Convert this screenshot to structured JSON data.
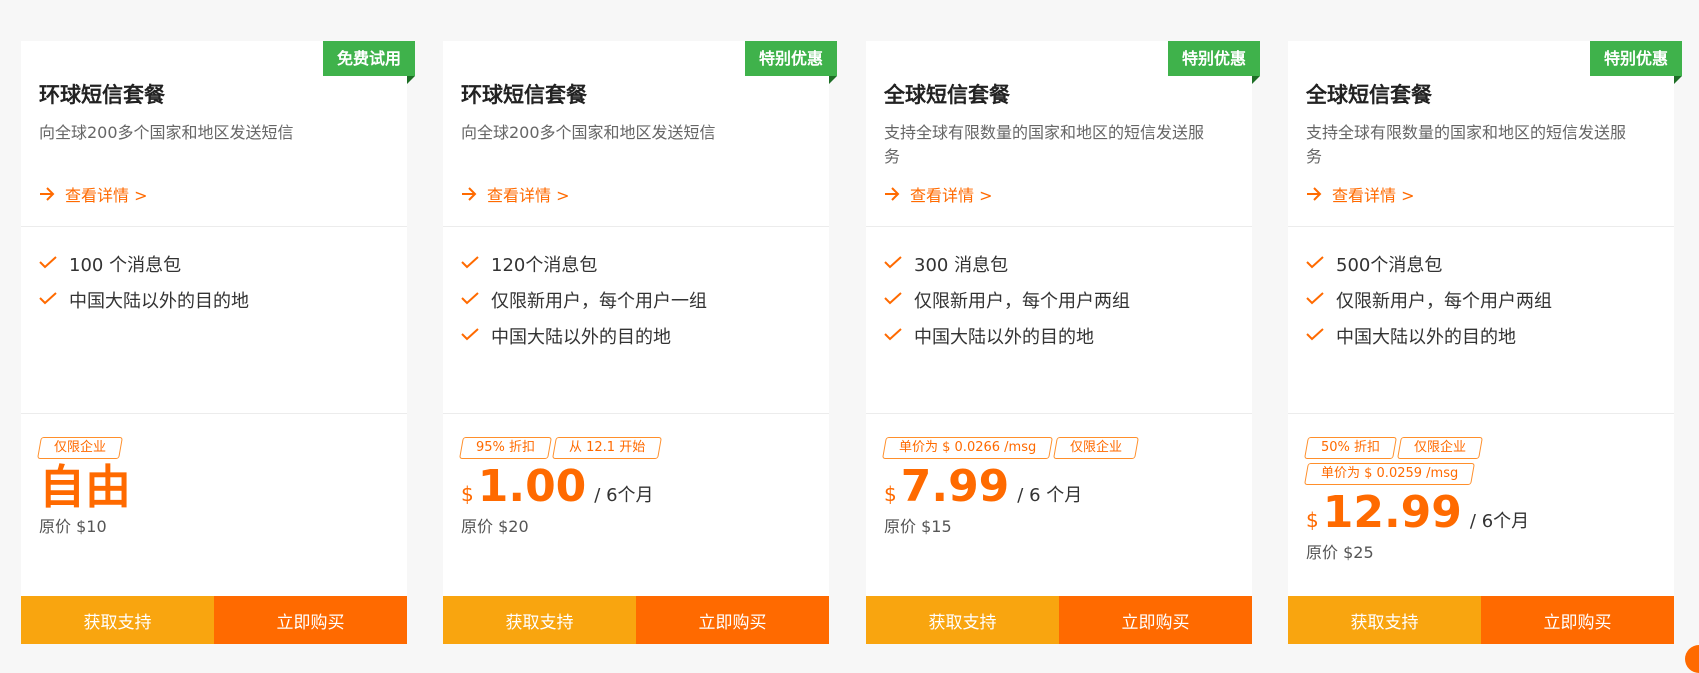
{
  "cards": [
    {
      "ribbon": "免费试用",
      "title": "环球短信套餐",
      "desc": "向全球200多个国家和地区发送短信",
      "detail": "查看详情 >",
      "features": [
        "100 个消息包",
        "中国大陆以外的目的地"
      ],
      "tags": [
        "仅限企业"
      ],
      "currency": "",
      "price": "自由",
      "period": "",
      "original": "原价 $10",
      "support_label": "获取支持",
      "buy_label": "立即购买"
    },
    {
      "ribbon": "特别优惠",
      "title": "环球短信套餐",
      "desc": "向全球200多个国家和地区发送短信",
      "detail": "查看详情 >",
      "features": [
        "120个消息包",
        "仅限新用户，每个用户一组",
        "中国大陆以外的目的地"
      ],
      "tags": [
        "95% 折扣",
        "从 12.1 开始"
      ],
      "currency": "$",
      "price": "1.00",
      "period": "/ 6个月",
      "original": "原价 $20",
      "support_label": "获取支持",
      "buy_label": "立即购买"
    },
    {
      "ribbon": "特别优惠",
      "title": "全球短信套餐",
      "desc": "支持全球有限数量的国家和地区的短信发送服务",
      "detail": "查看详情 >",
      "features": [
        "300 消息包",
        "仅限新用户，每个用户两组",
        "中国大陆以外的目的地"
      ],
      "tags": [
        "单价为 $ 0.0266 /msg",
        "仅限企业"
      ],
      "currency": "$",
      "price": "7.99",
      "period": "/ 6 个月",
      "original": "原价 $15",
      "support_label": "获取支持",
      "buy_label": "立即购买"
    },
    {
      "ribbon": "特别优惠",
      "title": "全球短信套餐",
      "desc": "支持全球有限数量的国家和地区的短信发送服务",
      "detail": "查看详情 >",
      "features": [
        "500个消息包",
        "仅限新用户，每个用户两组",
        "中国大陆以外的目的地"
      ],
      "tags": [
        "50% 折扣",
        "仅限企业",
        "单价为 $ 0.0259 /msg"
      ],
      "currency": "$",
      "price": "12.99",
      "period": "/ 6个月",
      "original": "原价 $25",
      "support_label": "获取支持",
      "buy_label": "立即购买"
    }
  ],
  "colors": {
    "accent": "#ff6a00",
    "support_button": "#f9a50f",
    "ribbon": "#3fb24b"
  },
  "icons": {
    "detail": "arrow-right-icon",
    "feature": "checkmark-icon"
  }
}
